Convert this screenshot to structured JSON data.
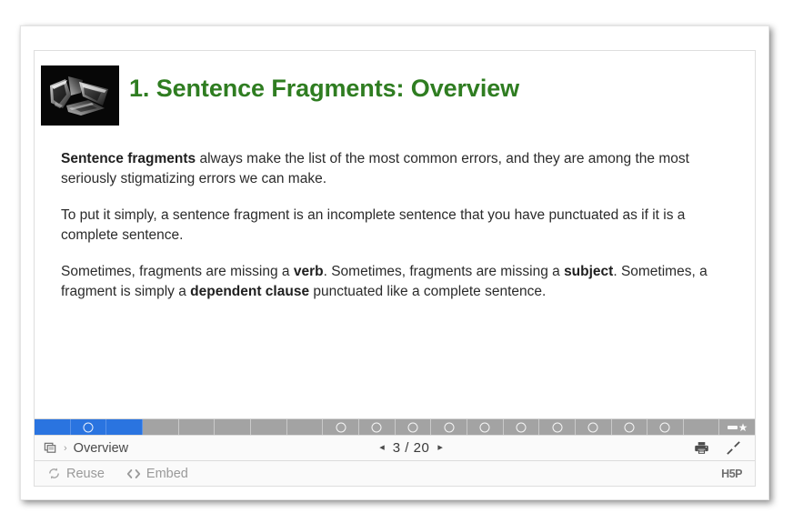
{
  "slide": {
    "title": "1. Sentence Fragments: Overview",
    "title_color": "#2f7d21",
    "thumbnail_alt": "broken-glass-photo",
    "paragraphs": [
      {
        "parts": [
          {
            "text": "Sentence fragments",
            "bold": true
          },
          {
            "text": " always make the list of the most common errors, and they are among the most seriously stigmatizing errors we can make.",
            "bold": false
          }
        ]
      },
      {
        "parts": [
          {
            "text": "To put it simply, a sentence fragment is an incomplete sentence that you have punctuated as if it is a complete sentence.",
            "bold": false
          }
        ]
      },
      {
        "parts": [
          {
            "text": "Sometimes, fragments are missing a ",
            "bold": false
          },
          {
            "text": "verb",
            "bold": true
          },
          {
            "text": ". Sometimes, fragments are missing a ",
            "bold": false
          },
          {
            "text": "subject",
            "bold": true
          },
          {
            "text": ". Sometimes, a fragment is simply a ",
            "bold": false
          },
          {
            "text": "dependent clause",
            "bold": true
          },
          {
            "text": " punctuated like a complete sentence.",
            "bold": false
          }
        ]
      }
    ]
  },
  "progress": {
    "total_segments": 20,
    "completed_count": 3,
    "active_index": 1,
    "colors": {
      "done": "#2a74e0",
      "pending": "#a3a3a3"
    },
    "segments": [
      {
        "done": true,
        "ring": false
      },
      {
        "done": true,
        "ring": true
      },
      {
        "done": true,
        "ring": false
      },
      {
        "done": false,
        "ring": false
      },
      {
        "done": false,
        "ring": false
      },
      {
        "done": false,
        "ring": false
      },
      {
        "done": false,
        "ring": false
      },
      {
        "done": false,
        "ring": false
      },
      {
        "done": false,
        "ring": true
      },
      {
        "done": false,
        "ring": true
      },
      {
        "done": false,
        "ring": true
      },
      {
        "done": false,
        "ring": true
      },
      {
        "done": false,
        "ring": true
      },
      {
        "done": false,
        "ring": true
      },
      {
        "done": false,
        "ring": true
      },
      {
        "done": false,
        "ring": true
      },
      {
        "done": false,
        "ring": true
      },
      {
        "done": false,
        "ring": true
      },
      {
        "done": false,
        "ring": false
      },
      {
        "done": false,
        "ring": false,
        "summary": true
      }
    ]
  },
  "footer": {
    "slide_icon": "slides-icon",
    "separator": "›",
    "slide_name": "Overview",
    "prev_label": "◂",
    "next_label": "▸",
    "current_page": "3",
    "page_divider": "/",
    "total_pages": "20",
    "print_icon": "printer-icon",
    "fullscreen_icon": "fullscreen-icon"
  },
  "actions": {
    "reuse_label": "Reuse",
    "reuse_icon": "refresh-icon",
    "embed_label": "Embed",
    "embed_icon": "code-brackets-icon",
    "logo_text": "H5P"
  }
}
